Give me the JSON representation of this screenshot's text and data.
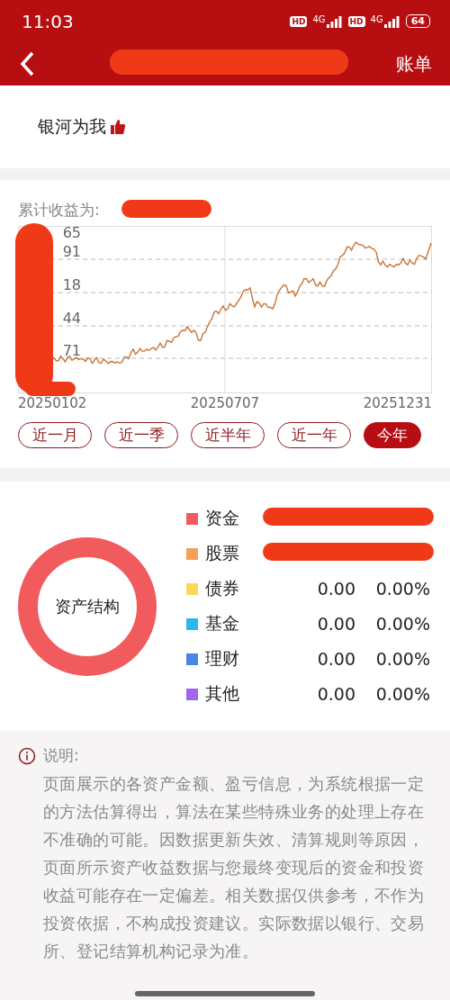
{
  "status_bar": {
    "time": "11:03",
    "networks": [
      {
        "badge": "HD",
        "type": "4G"
      },
      {
        "badge": "HD",
        "type": "4G"
      }
    ],
    "battery": "64"
  },
  "nav": {
    "action": "账单"
  },
  "banner": {
    "title": "银河为我"
  },
  "returns": {
    "label": "累计收益为:",
    "y_labels": [
      "65",
      "91",
      "18",
      "44",
      "71"
    ],
    "x_labels": [
      "20250102",
      "20250707",
      "20251231"
    ],
    "ranges": [
      {
        "label": "近一月",
        "selected": false
      },
      {
        "label": "近一季",
        "selected": false
      },
      {
        "label": "近半年",
        "selected": false
      },
      {
        "label": "近一年",
        "selected": false
      },
      {
        "label": "今年",
        "selected": true
      }
    ]
  },
  "assets": {
    "title": "资产结构",
    "items": [
      {
        "name": "资金",
        "color": "#f25b5e"
      },
      {
        "name": "股票",
        "color": "#f5a05a"
      },
      {
        "name": "债券",
        "color": "#fbd85a",
        "amount": "0.00",
        "percent": "0.00%"
      },
      {
        "name": "基金",
        "color": "#2cb5ef",
        "amount": "0.00",
        "percent": "0.00%"
      },
      {
        "name": "理财",
        "color": "#4a86e8",
        "amount": "0.00",
        "percent": "0.00%"
      },
      {
        "name": "其他",
        "color": "#a066f0",
        "amount": "0.00",
        "percent": "0.00%"
      }
    ]
  },
  "notice": {
    "title": "说明:",
    "body": "页面展示的各资产金额、盈亏信息，为系统根据一定的方法估算得出，算法在某些特殊业务的处理上存在不准确的可能。因数据更新失效、清算规则等原因，页面所示资产收益数据与您最终变现后的资金和投资收益可能存在一定偏差。相关数据仅供参考，不作为投资依据，不构成投资建议。实际数据以银行、交易所、登记结算机构记录为准。"
  }
}
